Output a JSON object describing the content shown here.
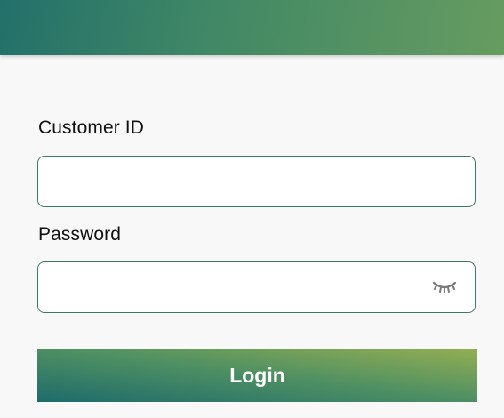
{
  "form": {
    "customer_id": {
      "label": "Customer ID",
      "value": "",
      "placeholder": ""
    },
    "password": {
      "label": "Password",
      "value": "",
      "placeholder": "",
      "toggle_icon": "eye-closed-icon"
    },
    "login_label": "Login"
  },
  "colors": {
    "header_gradient_start": "#23706a",
    "header_gradient_end": "#679c60",
    "field_border": "#3d7a66",
    "button_gradient_start": "#1e6b6b",
    "button_gradient_end": "#94ae52",
    "page_background": "#f8f8f8"
  }
}
